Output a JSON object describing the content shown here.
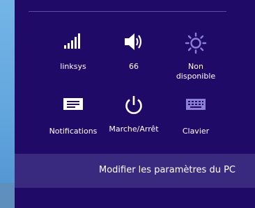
{
  "quick_settings": [
    {
      "label": "linksys",
      "icon": "wifi-signal-icon"
    },
    {
      "label": "66",
      "icon": "speaker-volume-icon"
    },
    {
      "label": "Non\ndisponible",
      "icon": "brightness-icon",
      "icon_color": "#8c7fd6"
    },
    {
      "label": "Notifications",
      "icon": "notifications-icon"
    },
    {
      "label": "Marche/Arrêt",
      "icon": "power-icon"
    },
    {
      "label": "Clavier",
      "icon": "keyboard-icon",
      "icon_color": "#8c7fd6"
    }
  ],
  "footer": {
    "change_settings_label": "Modifier les paramètres du PC"
  },
  "colors": {
    "panel_bg": "#1f0a68",
    "footer_bg": "#3a2a7f",
    "desktop_blue": "#6aaee2"
  }
}
